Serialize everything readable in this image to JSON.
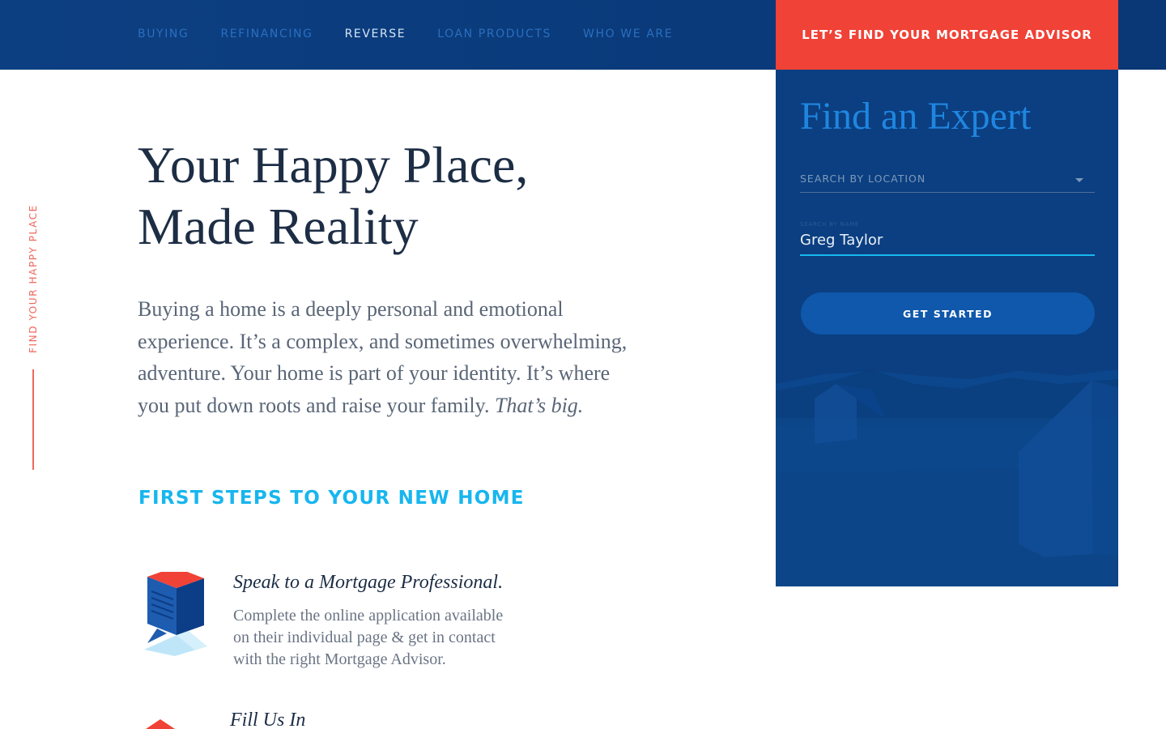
{
  "nav": {
    "items": [
      {
        "label": "BUYING",
        "active": false
      },
      {
        "label": "REFINANCING",
        "active": false
      },
      {
        "label": "REVERSE",
        "active": true
      },
      {
        "label": "LOAN PRODUCTS",
        "active": false
      },
      {
        "label": "WHO WE ARE",
        "active": false
      }
    ],
    "cta_label": "LET’S FIND YOUR MORTGAGE ADVISOR"
  },
  "side": {
    "label": "FIND YOUR HAPPY PLACE"
  },
  "hero": {
    "title_lines": [
      "Your Happy Place,",
      "Made Reality"
    ],
    "body_lines": [
      "Buying a home is a deeply personal and emotional",
      "experience. It’s a complex, and sometimes overwhelming,",
      "adventure. Your home is part of your identity. It’s where",
      "you put down roots and raise your family. "
    ],
    "body_emphasis": "That’s big."
  },
  "steps": {
    "heading": "FIRST STEPS TO YOUR NEW HOME",
    "items": [
      {
        "title": "Speak to a Mortgage Professional.",
        "desc_lines": [
          "Complete the online application available",
          "on their individual page & get in contact",
          "with the right Mortgage Advisor."
        ]
      },
      {
        "title": "Fill Us In"
      }
    ]
  },
  "expert_panel": {
    "title": "Find an Expert",
    "location_placeholder": "SEARCH BY LOCATION",
    "name_label": "SEARCH BY NAME",
    "name_value": "Greg Taylor",
    "button_label": "GET STARTED"
  },
  "colors": {
    "navy": "#0b3f81",
    "accent_red": "#f04236",
    "accent_cyan": "#16b9ee",
    "heading_dark": "#1c2d44"
  }
}
